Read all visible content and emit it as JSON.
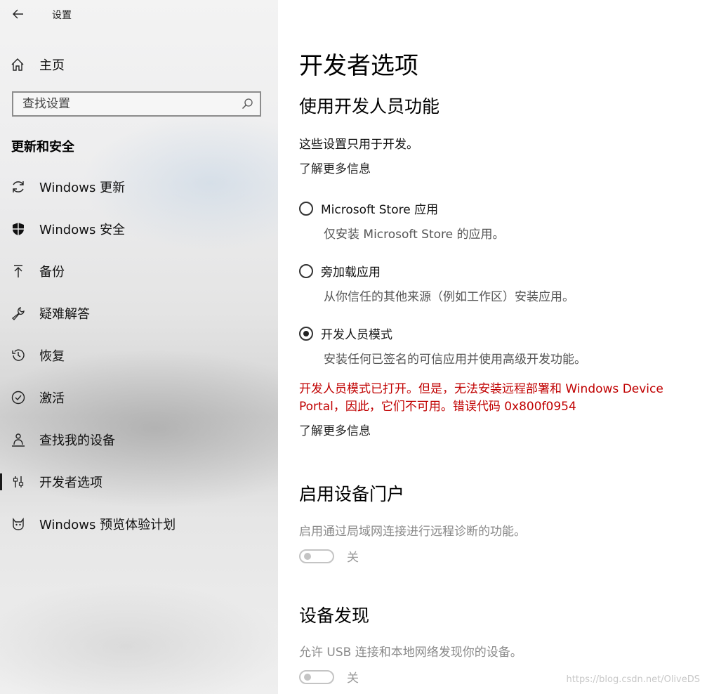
{
  "app": {
    "title": "设置"
  },
  "sidebar": {
    "home_label": "主页",
    "search": {
      "placeholder": "查找设置"
    },
    "section_title": "更新和安全",
    "items": [
      {
        "label": "Windows 更新",
        "icon": "refresh-icon"
      },
      {
        "label": "Windows 安全",
        "icon": "shield-icon"
      },
      {
        "label": "备份",
        "icon": "upload-arrow-icon"
      },
      {
        "label": "疑难解答",
        "icon": "wrench-icon"
      },
      {
        "label": "恢复",
        "icon": "history-icon"
      },
      {
        "label": "激活",
        "icon": "check-circle-icon"
      },
      {
        "label": "查找我的设备",
        "icon": "person-location-icon"
      },
      {
        "label": "开发者选项",
        "icon": "developer-sliders-icon",
        "selected": true
      },
      {
        "label": "Windows 预览体验计划",
        "icon": "cat-icon"
      }
    ]
  },
  "main": {
    "page_title": "开发者选项",
    "dev_section": {
      "title": "使用开发人员功能",
      "intro": "这些设置只用于开发。",
      "learn_more": "了解更多信息",
      "options": [
        {
          "label": "Microsoft Store 应用",
          "desc": "仅安装 Microsoft Store 的应用。",
          "selected": false
        },
        {
          "label": "旁加载应用",
          "desc": "从你信任的其他来源（例如工作区）安装应用。",
          "selected": false
        },
        {
          "label": "开发人员模式",
          "desc": "安装任何已签名的可信应用并使用高级开发功能。",
          "selected": true
        }
      ],
      "error_text": "开发人员模式已打开。但是，无法安装远程部署和 Windows Device Portal，因此，它们不可用。错误代码 0x800f0954",
      "learn_more_2": "了解更多信息"
    },
    "portal_section": {
      "title": "启用设备门户",
      "desc": "启用通过局域网连接进行远程诊断的功能。",
      "toggle_label": "关",
      "toggle_on": false
    },
    "discovery_section": {
      "title": "设备发现",
      "desc": "允许 USB 连接和本地网络发现你的设备。",
      "toggle_label": "关",
      "toggle_on": false
    }
  },
  "watermark": "https://blog.csdn.net/OliveDS",
  "colors": {
    "error": "#c00000",
    "muted": "#8a8a8a",
    "selected_indicator": "#1a1a1a"
  }
}
